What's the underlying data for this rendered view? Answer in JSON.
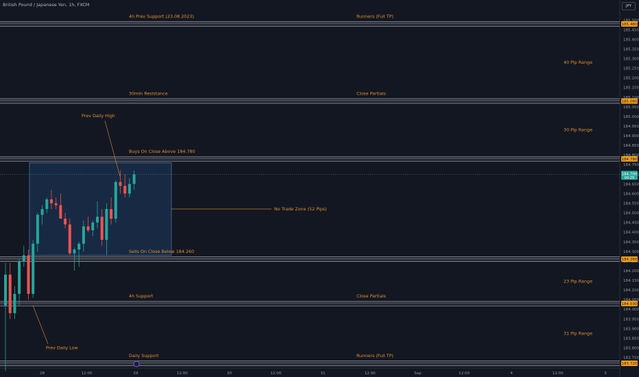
{
  "header": {
    "symbol_title": "British Pound / Japanese Yen, 1h, FXCM",
    "currency": "JPY"
  },
  "colors": {
    "background": "#131722",
    "up": "#26a69a",
    "down": "#ef5350",
    "zone_line": "#9598a1",
    "annotation_text": "#e0902e",
    "price_tag": "#f7a21b",
    "current_tag": "#26a69a",
    "box_fill": "#1e3a5f",
    "box_border": "#4a72a8"
  },
  "chart_data": {
    "type": "candlestick",
    "ylim": [
      183.72,
      185.54
    ],
    "y_ticks": [
      "185.500",
      "185.450",
      "185.400",
      "185.350",
      "185.300",
      "185.250",
      "185.200",
      "185.150",
      "185.100",
      "185.050",
      "185.000",
      "184.950",
      "184.900",
      "184.850",
      "184.800",
      "184.750",
      "184.700",
      "184.650",
      "184.600",
      "184.550",
      "184.500",
      "184.450",
      "184.400",
      "184.350",
      "184.300",
      "184.250",
      "184.200",
      "184.150",
      "184.100",
      "184.050",
      "184.000",
      "183.950",
      "183.900",
      "183.850",
      "183.800",
      "183.750"
    ],
    "x_ticks": [
      {
        "label": "28",
        "pos": 0.068
      },
      {
        "label": "12:00",
        "pos": 0.14
      },
      {
        "label": "29",
        "pos": 0.219
      },
      {
        "label": "12:00",
        "pos": 0.294
      },
      {
        "label": "30",
        "pos": 0.37
      },
      {
        "label": "12:00",
        "pos": 0.445
      },
      {
        "label": "31",
        "pos": 0.521
      },
      {
        "label": "12:00",
        "pos": 0.597
      },
      {
        "label": "Sep",
        "pos": 0.674
      },
      {
        "label": "12:00",
        "pos": 0.749
      },
      {
        "label": "4",
        "pos": 0.825
      },
      {
        "label": "12:00",
        "pos": 0.9
      },
      {
        "label": "5",
        "pos": 0.977
      }
    ],
    "candles": [
      {
        "o": 184.02,
        "h": 184.24,
        "l": 183.68,
        "c": 184.18
      },
      {
        "o": 184.18,
        "h": 184.24,
        "l": 183.95,
        "c": 183.98
      },
      {
        "o": 183.98,
        "h": 184.12,
        "l": 183.95,
        "c": 184.08
      },
      {
        "o": 184.08,
        "h": 184.26,
        "l": 184.02,
        "c": 184.25
      },
      {
        "o": 184.25,
        "h": 184.33,
        "l": 184.22,
        "c": 184.28
      },
      {
        "o": 184.28,
        "h": 184.31,
        "l": 184.05,
        "c": 184.08
      },
      {
        "o": 184.08,
        "h": 184.36,
        "l": 184.06,
        "c": 184.34
      },
      {
        "o": 184.34,
        "h": 184.5,
        "l": 184.3,
        "c": 184.49
      },
      {
        "o": 184.49,
        "h": 184.54,
        "l": 184.44,
        "c": 184.52
      },
      {
        "o": 184.52,
        "h": 184.58,
        "l": 184.5,
        "c": 184.57
      },
      {
        "o": 184.57,
        "h": 184.62,
        "l": 184.52,
        "c": 184.55
      },
      {
        "o": 184.55,
        "h": 184.58,
        "l": 184.52,
        "c": 184.54
      },
      {
        "o": 184.54,
        "h": 184.6,
        "l": 184.5,
        "c": 184.47
      },
      {
        "o": 184.47,
        "h": 184.5,
        "l": 184.42,
        "c": 184.44
      },
      {
        "o": 184.44,
        "h": 184.47,
        "l": 184.28,
        "c": 184.29
      },
      {
        "o": 184.29,
        "h": 184.32,
        "l": 184.2,
        "c": 184.31
      },
      {
        "o": 184.31,
        "h": 184.35,
        "l": 184.22,
        "c": 184.34
      },
      {
        "o": 184.34,
        "h": 184.46,
        "l": 184.3,
        "c": 184.43
      },
      {
        "o": 184.43,
        "h": 184.48,
        "l": 184.4,
        "c": 184.41
      },
      {
        "o": 184.41,
        "h": 184.46,
        "l": 184.38,
        "c": 184.45
      },
      {
        "o": 184.45,
        "h": 184.56,
        "l": 184.42,
        "c": 184.48
      },
      {
        "o": 184.48,
        "h": 184.52,
        "l": 184.33,
        "c": 184.36
      },
      {
        "o": 184.36,
        "h": 184.55,
        "l": 184.28,
        "c": 184.52
      },
      {
        "o": 184.52,
        "h": 184.58,
        "l": 184.44,
        "c": 184.47
      },
      {
        "o": 184.47,
        "h": 184.67,
        "l": 184.45,
        "c": 184.66
      },
      {
        "o": 184.66,
        "h": 184.72,
        "l": 184.6,
        "c": 184.64
      },
      {
        "o": 184.64,
        "h": 184.7,
        "l": 184.58,
        "c": 184.6
      },
      {
        "o": 184.6,
        "h": 184.68,
        "l": 184.58,
        "c": 184.65
      },
      {
        "o": 184.65,
        "h": 184.72,
        "l": 184.62,
        "c": 184.7
      }
    ],
    "current_price": {
      "value": 184.7,
      "label": "184.700",
      "countdown": "00:29"
    },
    "levels": [
      {
        "price": 185.48,
        "label": "185.480",
        "left": "4h Prev Support (23.08.2023)",
        "right": "Runners (Full TP)"
      },
      {
        "price": 185.08,
        "label": "185.080",
        "left": "30min Resistance",
        "right": "Close Partials"
      },
      {
        "price": 184.78,
        "label": "184.780",
        "left": "Buys On Close Above 184.780",
        "right": ""
      },
      {
        "price": 184.26,
        "label": "184.260",
        "left": "Sells On Close Below 184.260",
        "right": ""
      },
      {
        "price": 184.03,
        "label": "184.030",
        "left": "4h Support",
        "right": "Close Partials"
      },
      {
        "price": 183.72,
        "label": "183.720",
        "left": "Daily Support",
        "right": "Runners (Full TP)"
      }
    ],
    "ranges": [
      "40 Pip Range",
      "30 Pip Range",
      "23 Pip Range",
      "31 Pip Range"
    ],
    "zone_label": "No Trade Zone (52 Pips)",
    "zone_range": [
      184.28,
      184.76
    ],
    "prev_daily_high": "Prev Daily High",
    "prev_daily_low": "Prev Daily Low"
  }
}
